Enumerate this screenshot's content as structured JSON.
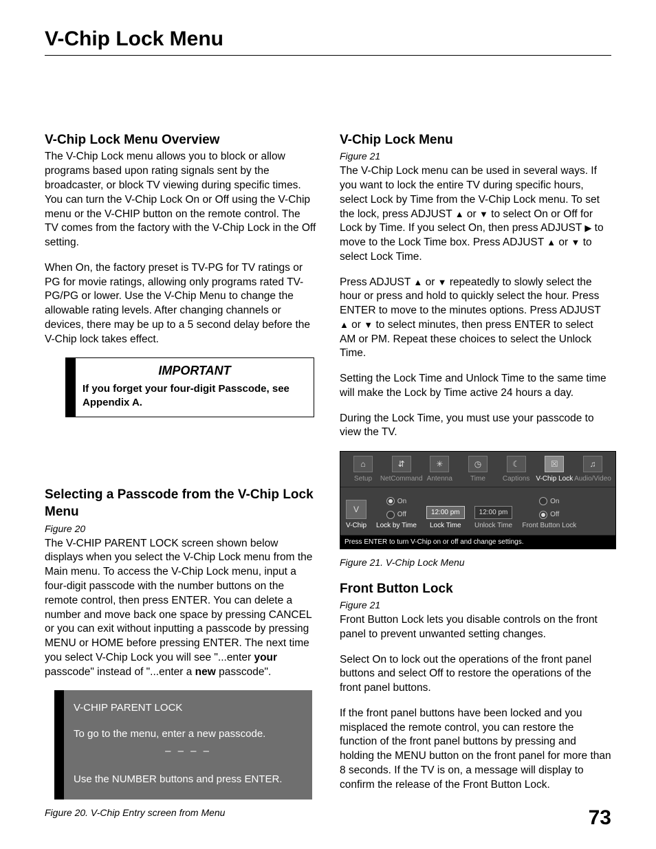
{
  "page": {
    "title": "V-Chip Lock Menu",
    "number": "73"
  },
  "left": {
    "overview_h": "V-Chip Lock Menu Overview",
    "overview_p1": "The V-Chip Lock menu allows you to block or allow programs based upon rating signals sent by the broadcaster, or block TV viewing during specific times.  You can turn the V-Chip Lock On or Off using the V-Chip menu or the V-CHIP button on the remote control.  The TV comes from the factory with the V-Chip Lock in the Off setting.",
    "overview_p2": "When On, the factory preset is TV-PG for TV ratings or PG for movie ratings, allowing only programs rated TV-PG/PG or lower.  Use the V-Chip Menu to change the allowable rating levels.  After changing channels or devices, there may be up to a 5 second delay before the V-Chip lock takes effect.",
    "important_title": "IMPORTANT",
    "important_text": "If you forget your four-digit Passcode, see Appendix A.",
    "passcode_h": "Selecting a Passcode from the V-Chip Lock Menu",
    "passcode_fig": "Figure 20",
    "passcode_p1a": "The V-CHIP PARENT LOCK screen shown below displays when you select the V-Chip Lock menu from the Main menu.  To access the V-Chip Lock menu, input a four-digit passcode with the number buttons on the remote control, then press ENTER.  You can delete a number and move back one space by pressing CANCEL or you can exit without inputting a passcode by pressing MENU or HOME before pressing ENTER. The next time you select V-Chip Lock you will see \"...enter ",
    "passcode_bold_your": "your",
    "passcode_p1b": " passcode\" instead of \"...enter a ",
    "passcode_bold_new": "new",
    "passcode_p1c": " passcode\".",
    "pl_title": "V-CHIP PARENT LOCK",
    "pl_line1": "To go to the menu, enter a new passcode.",
    "pl_dashes": "– – – –",
    "pl_line2": "Use the NUMBER buttons and press ENTER.",
    "fig20_caption": "Figure 20. V-Chip Entry screen from Menu"
  },
  "right": {
    "menu_h": "V-Chip Lock Menu",
    "menu_fig": "Figure 21",
    "menu_p1a": "The V-Chip Lock menu can be used in several ways. If you want to lock the entire TV during specific hours, select Lock by Time from the V-Chip Lock menu.   To set the lock, press ADJUST ",
    "menu_p1b": " or ",
    "menu_p1c": " to select On or Off for Lock by Time.  If you select On, then press ADJUST ",
    "menu_p1d": " to move to the Lock Time box.  Press ADJUST ",
    "menu_p1e": " or ",
    "menu_p1f": " to select Lock Time.",
    "menu_p2a": "Press ADJUST ",
    "menu_p2b": " or ",
    "menu_p2c": "  repeatedly to slowly select the hour or press and hold to quickly select the hour.  Press ENTER to move to the minutes options.  Press ADJUST ",
    "menu_p2d": " or ",
    "menu_p2e": " to select minutes, then press ENTER to select AM or PM.  Repeat these choices to select the Unlock Time.",
    "menu_p3": "Setting the Lock Time and Unlock Time to the same time will make the Lock by Time active 24 hours a day.",
    "menu_p4": "During the Lock Time, you must use your passcode to view the TV.",
    "mock": {
      "tabs": [
        "Setup",
        "NetCommand",
        "Antenna",
        "Time",
        "Captions",
        "V-Chip Lock",
        "Audio/Video"
      ],
      "lbl_vchip": "V-Chip",
      "lbl_lockby": "Lock by Time",
      "lbl_locktime": "Lock Time",
      "lbl_unlocktime": "Unlock Time",
      "lbl_front": "Front Button Lock",
      "radio_on": "On",
      "radio_off": "Off",
      "time_lock": "12:00 pm",
      "time_unlock": "12:00 pm",
      "footer": "Press ENTER to turn V-Chip on or off and change settings."
    },
    "fig21_caption": "Figure 21. V-Chip Lock Menu",
    "front_h": "Front Button Lock",
    "front_fig": "Figure 21",
    "front_p1": "Front Button Lock lets you disable controls on the front panel to prevent unwanted setting changes.",
    "front_p2": "Select On to lock out the operations of the front panel buttons and select Off to restore the operations of the front panel buttons.",
    "front_p3": "If the front panel buttons have been locked and you misplaced the remote control, you can restore the function of the front panel buttons by pressing and holding the MENU button on the front panel for more than 8 seconds.  If the TV is on, a message will display to confirm the release of the Front Button Lock."
  },
  "glyph": {
    "up": "▲",
    "down": "▼",
    "right": "▶"
  }
}
